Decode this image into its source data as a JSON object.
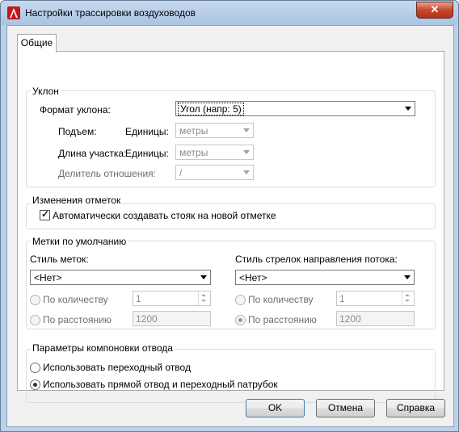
{
  "window": {
    "title": "Настройки трассировки воздуховодов",
    "close_label": "✕"
  },
  "tabs": [
    {
      "label": "Общие",
      "selected": true
    }
  ],
  "slope": {
    "group_label": "Уклон",
    "format_label": "Формат уклона:",
    "format_value": "Угол (напр: 5)",
    "rise_label": "Подъем:",
    "rise_units_label": "Единицы:",
    "rise_units_value": "метры",
    "run_label": "Длина участка:",
    "run_units_label": "Единицы:",
    "run_units_value": "метры",
    "ratio_label": "Делитель отношения:",
    "ratio_value": "/"
  },
  "elevation": {
    "group_label": "Изменения отметок",
    "auto_riser_label": "Автоматически создавать стояк на новой отметке",
    "auto_riser_checked": true
  },
  "labels": {
    "group_label": "Метки по умолчанию",
    "left": {
      "style_label": "Стиль меток:",
      "style_value": "<Нет>",
      "by_quantity_label": "По количеству",
      "quantity_value": "1",
      "by_distance_label": "По расстоянию",
      "distance_value": "1200",
      "selected": "none"
    },
    "right": {
      "style_label": "Стиль стрелок направления потока:",
      "style_value": "<Нет>",
      "by_quantity_label": "По количеству",
      "quantity_value": "1",
      "by_distance_label": "По расстоянию",
      "distance_value": "1200",
      "selected": "distance"
    }
  },
  "elbow": {
    "group_label": "Параметры компоновки отвода",
    "option1_label": "Использовать переходный отвод",
    "option2_label": "Использовать прямой отвод и переходный патрубок",
    "selected": "option2"
  },
  "buttons": {
    "ok": "OK",
    "cancel": "Отмена",
    "help": "Справка"
  },
  "colors": {
    "titlebar": "#b9d1ea",
    "close_button": "#c7452b",
    "dialog_bg": "#f0f0f0"
  }
}
